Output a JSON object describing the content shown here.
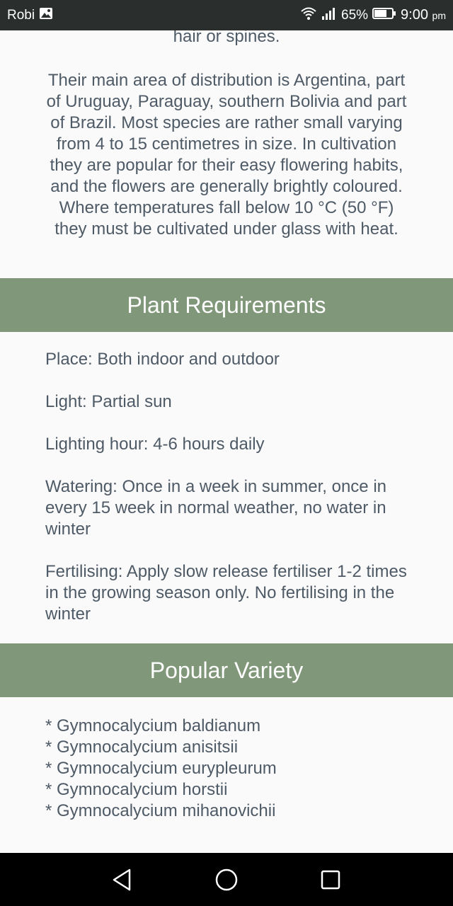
{
  "status_bar": {
    "carrier": "Robi",
    "battery": "65%",
    "time": "9:00",
    "time_suffix": "pm"
  },
  "intro": {
    "tail": "hair or spines.",
    "distribution": "Their main area of distribution is Argentina, part of Uruguay, Paraguay, southern Bolivia and part of Brazil. Most species are rather small varying from 4 to 15 centimetres in size. In cultivation they are popular for their easy flowering habits, and the flowers are generally brightly coloured. Where temperatures fall below 10 °C (50 °F) they must be cultivated under glass with heat."
  },
  "requirements": {
    "title": "Plant Requirements",
    "place": "Place: Both indoor and outdoor",
    "light": "Light: Partial sun",
    "lighting_hour": "Lighting hour: 4-6 hours daily",
    "watering": "Watering: Once in a week in summer, once in every 15 week in normal weather, no water in winter",
    "fertilising": "Fertilising: Apply slow release fertiliser 1-2 times in the growing season only. No fertilising in the winter"
  },
  "varieties": {
    "title": "Popular Variety",
    "items": [
      "* Gymnocalycium baldianum",
      "* Gymnocalycium anisitsii",
      "* Gymnocalycium eurypleurum",
      "* Gymnocalycium horstii",
      "* Gymnocalycium mihanovichii"
    ]
  },
  "colors": {
    "header_bg": "#80977a",
    "status_bar_bg": "#2a2f2d",
    "nav_bar_bg": "#000000",
    "text": "#4e5a66"
  },
  "icons": {
    "status_left": "image-icon",
    "wifi": "wifi-icon",
    "signal": "signal-icon",
    "battery": "battery-icon",
    "nav_back": "back-icon",
    "nav_home": "home-icon",
    "nav_recents": "recents-icon"
  }
}
